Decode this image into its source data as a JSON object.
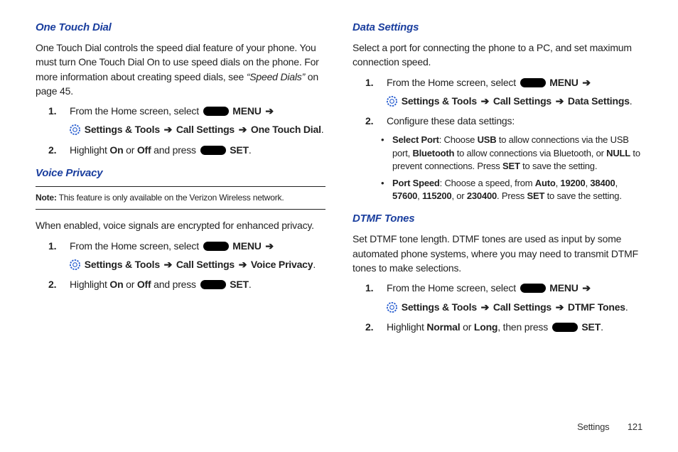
{
  "footer": {
    "section": "Settings",
    "page": "121"
  },
  "icons": {
    "arrow": "➔"
  },
  "left": {
    "otd": {
      "header": "One Touch Dial",
      "intro_a": "One Touch Dial controls the speed dial feature of your phone. You must turn One Touch Dial On to use speed dials on the phone. For more information about creating speed dials, see ",
      "intro_ref": "“Speed Dials”",
      "intro_b": " on page 45.",
      "s1_a": "From the Home screen, select ",
      "s1_menu": " MENU ",
      "s1_path1": " Settings & Tools ",
      "s1_path2": " Call Settings ",
      "s1_path3": " One Touch Dial",
      "s2_a": "Highlight ",
      "s2_on": "On",
      "s2_or": " or ",
      "s2_off": "Off",
      "s2_press": " and press ",
      "s2_set": " SET"
    },
    "vp": {
      "header": "Voice Privacy",
      "note_label": "Note:",
      "note_text": " This feature is only available on the Verizon Wireless network.",
      "intro": "When enabled, voice signals are encrypted for enhanced privacy.",
      "s1_a": "From the Home screen, select ",
      "s1_menu": " MENU ",
      "s1_path1": " Settings & Tools ",
      "s1_path2": " Call Settings ",
      "s1_path3": " Voice Privacy",
      "s2_a": "Highlight ",
      "s2_on": "On",
      "s2_or": " or ",
      "s2_off": "Off",
      "s2_press": " and press ",
      "s2_set": " SET"
    }
  },
  "right": {
    "ds": {
      "header": "Data Settings",
      "intro": "Select a port for connecting the phone to a PC, and set maximum connection speed.",
      "s1_a": "From the Home screen, select ",
      "s1_menu": " MENU ",
      "s1_path1": " Settings & Tools ",
      "s1_path2": " Call Settings ",
      "s1_path3": " Data Settings",
      "s2": "Configure these data settings:",
      "b1_name": "Select Port",
      "b1_a": ": Choose ",
      "b1_usb": "USB",
      "b1_b": " to allow connections via the USB port, ",
      "b1_bt": "Bluetooth",
      "b1_c": " to allow connections via Bluetooth, or ",
      "b1_null": "NULL",
      "b1_d": " to prevent connections. Press ",
      "b1_set": "SET",
      "b1_e": " to save the setting.",
      "b2_name": "Port Speed",
      "b2_a": ": Choose a speed, from  ",
      "b2_auto": "Auto",
      "sep": ", ",
      "b2_19200": "19200",
      "b2_38400": "38400",
      "b2_57600": "57600",
      "b2_115200": "115200",
      "b2_or": ", or ",
      "b2_230400": "230400",
      "b2_press": ". Press ",
      "b2_set": "SET",
      "b2_e": " to save the setting."
    },
    "dtmf": {
      "header": "DTMF Tones",
      "intro": "Set DTMF tone length. DTMF tones are used as input by some automated phone systems, where you may need to transmit DTMF tones to make selections.",
      "s1_a": "From the Home screen, select ",
      "s1_menu": " MENU ",
      "s1_path1": " Settings & Tools ",
      "s1_path2": " Call Settings ",
      "s1_path3": " DTMF Tones",
      "s2_a": "Highlight ",
      "s2_normal": "Normal",
      "s2_or": " or ",
      "s2_long": "Long",
      "s2_press": ", then press ",
      "s2_set": " SET"
    }
  }
}
